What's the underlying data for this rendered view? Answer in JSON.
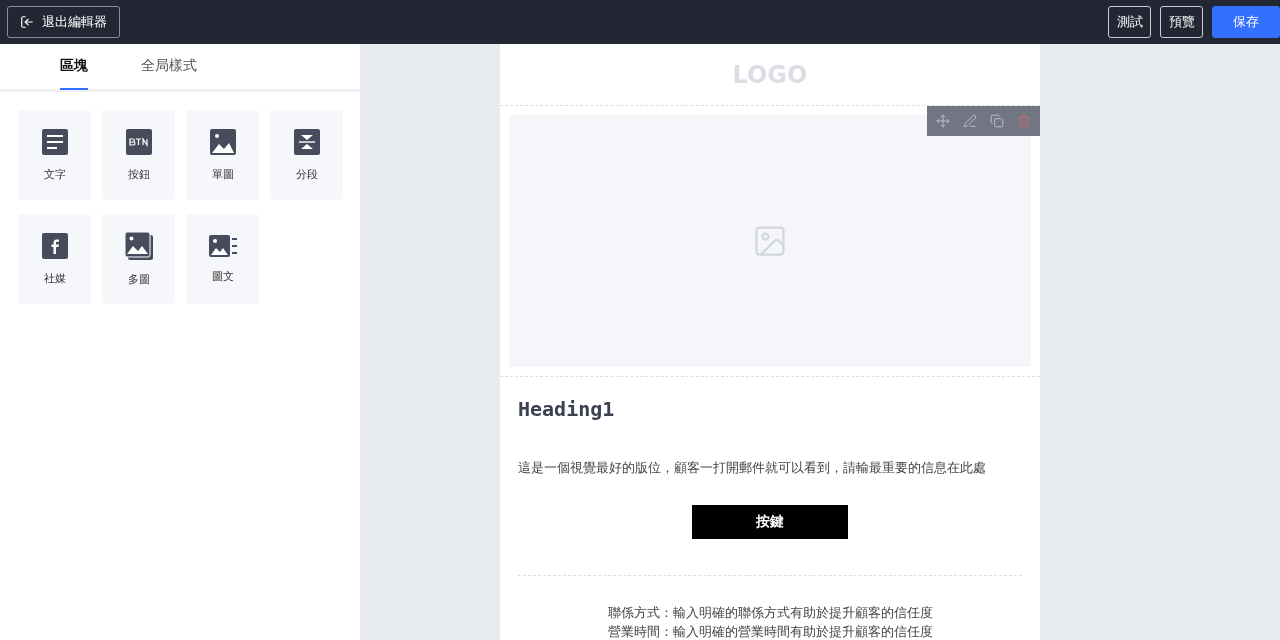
{
  "topbar": {
    "exit_label": "退出編輯器",
    "buttons": [
      {
        "label": "測試",
        "kind": "outline"
      },
      {
        "label": "預覽",
        "kind": "outline"
      },
      {
        "label": "保存",
        "kind": "primary"
      }
    ]
  },
  "sidebar": {
    "tabs": [
      {
        "label": "區塊",
        "selected": true
      },
      {
        "label": "全局樣式",
        "selected": false
      }
    ],
    "blocks": [
      {
        "label": "文字",
        "kind": "text"
      },
      {
        "label": "按鈕",
        "kind": "button"
      },
      {
        "label": "單圖",
        "kind": "image"
      },
      {
        "label": "分段",
        "kind": "divider"
      },
      {
        "label": "社媒",
        "kind": "social"
      },
      {
        "label": "多圖",
        "kind": "gallery"
      },
      {
        "label": "圖文",
        "kind": "imagetext"
      }
    ]
  },
  "email": {
    "logo": "LOGO",
    "heading": "Heading1",
    "paragraph": "這是一個視覺最好的版位，顧客一打開郵件就可以看到，請輸最重要的信息在此處",
    "button": "按鍵",
    "footer_lines": [
      "聯係方式：輸入明確的聯係方式有助於提升顧客的信任度",
      "營業時間：輸入明確的營業時間有助於提升顧客的信任度"
    ]
  }
}
